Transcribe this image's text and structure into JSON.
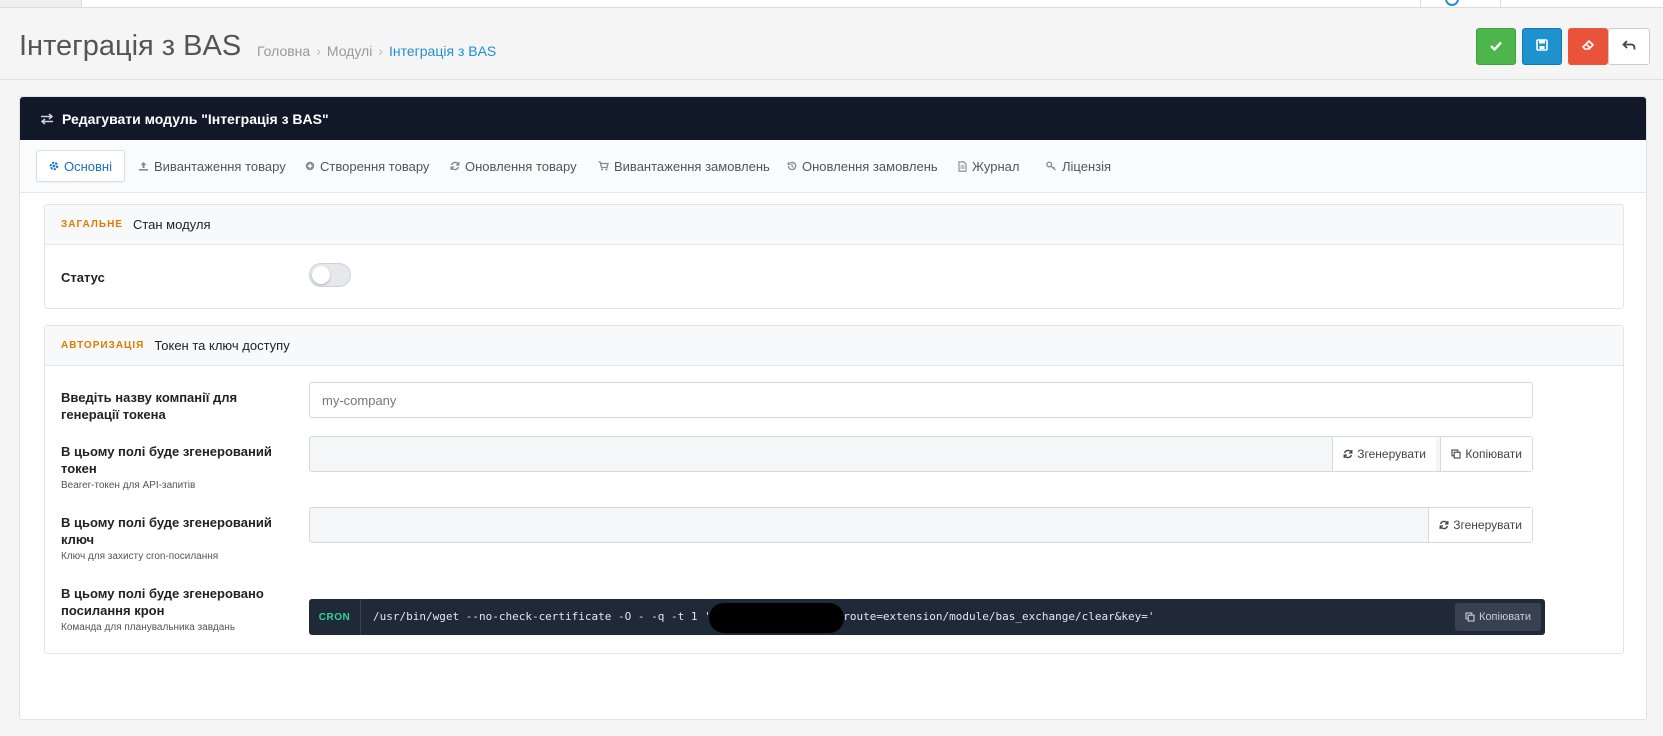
{
  "header": {
    "title": "Інтеграція з BAS",
    "breadcrumbs": [
      "Головна",
      "Модулі",
      "Інтеграція з BAS"
    ],
    "buttons": {
      "save_stay_icon": "check-icon",
      "save_icon": "floppy-disk-icon",
      "clear_icon": "eraser-icon",
      "back_icon": "reply-arrow-icon"
    }
  },
  "colors": {
    "green": "#4cb64c",
    "blue": "#1e91cf",
    "red": "#e8533a",
    "panel_head": "#111827",
    "section_tag": "#e07b00",
    "cron_bg": "#1f2937",
    "cron_badge": "#34d399"
  },
  "panel": {
    "title": "Редагувати модуль \"Інтеграція з BAS\"",
    "icon": "exchange-arrows-icon"
  },
  "tabs": [
    {
      "label": "Основні",
      "icon": "gear-icon",
      "active": true
    },
    {
      "label": "Вивантаження товару",
      "icon": "upload-icon"
    },
    {
      "label": "Створення товару",
      "icon": "plus-circle-icon"
    },
    {
      "label": "Оновлення товару",
      "icon": "refresh-icon"
    },
    {
      "label": "Вивантаження замовлень",
      "icon": "cart-icon"
    },
    {
      "label": "Оновлення замовлень",
      "icon": "history-icon"
    },
    {
      "label": "Журнал",
      "icon": "document-icon"
    },
    {
      "label": "Ліцензія",
      "icon": "key-icon"
    }
  ],
  "general": {
    "tag": "ЗАГАЛЬНЕ",
    "title": "Стан модуля",
    "status_label": "Статус",
    "status_on": false
  },
  "auth": {
    "tag": "АВТОРИЗАЦІЯ",
    "title": "Токен та ключ доступу",
    "company_label": "Введіть назву компанії для генерації токена",
    "company_placeholder": "my-company",
    "token_label": "В цьому полі буде згенерований токен",
    "token_hint": "Bearer-токен для API-запитів",
    "key_label": "В цьому полі буде згенерований ключ",
    "key_hint": "Ключ для захисту cron-посилання",
    "cron_label": "В цьому полі буде згенеровано посилання крон",
    "cron_hint": "Команда для планувальника завдань",
    "generate_label": "Згенерувати",
    "copy_label": "Копіювати",
    "cron_badge": "CRON",
    "cron_command": "/usr/bin/wget --no-check-certificate -O - -q -t 1 'https:/                   ./index.php?route=extension/module/bas_exchange/clear&key='"
  }
}
